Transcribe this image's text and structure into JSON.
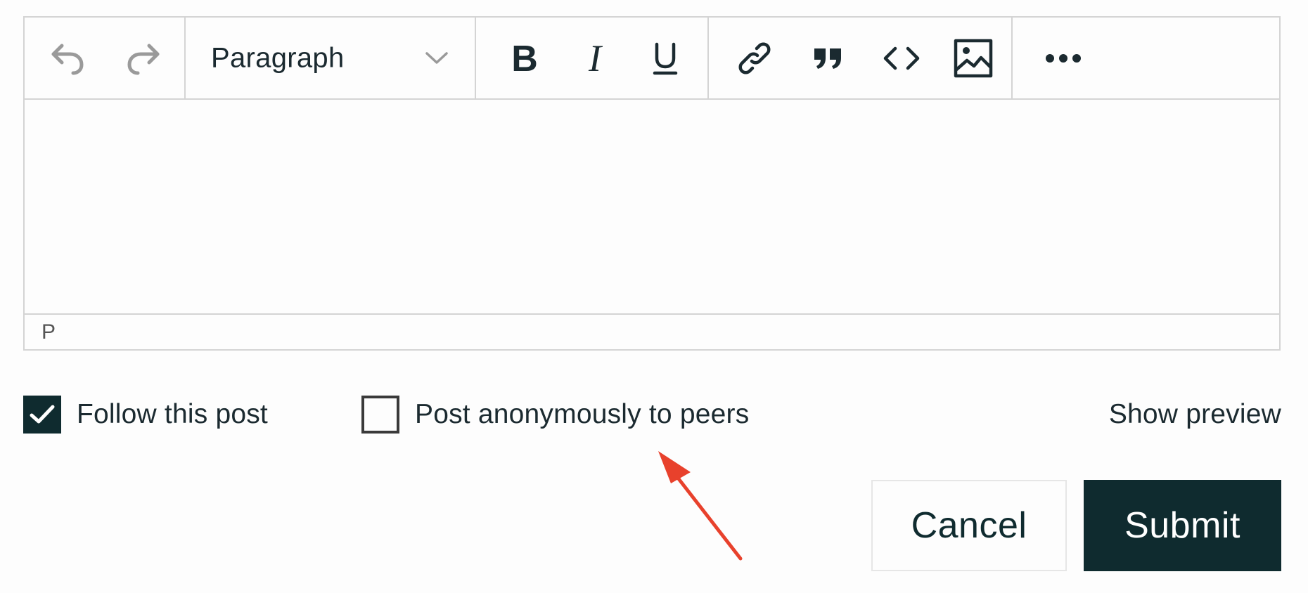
{
  "toolbar": {
    "undo_icon": "undo-icon",
    "redo_icon": "redo-icon",
    "block_format": {
      "selected": "Paragraph",
      "icon": "chevron-down-icon"
    },
    "text_format_icons": [
      "bold-icon",
      "italic-icon",
      "underline-icon"
    ],
    "insert_icons": [
      "link-icon",
      "blockquote-icon",
      "code-icon",
      "image-icon"
    ],
    "more_icon": "more-horizontal-icon"
  },
  "editor": {
    "content": "",
    "status_path": "P"
  },
  "options": {
    "follow_post": {
      "label": "Follow this post",
      "checked": true
    },
    "post_anonymously": {
      "label": "Post anonymously to peers",
      "checked": false
    },
    "show_preview_label": "Show preview"
  },
  "actions": {
    "cancel_label": "Cancel",
    "submit_label": "Submit"
  },
  "colors": {
    "primary_dark": "#0f2b2f",
    "border": "#d4d4d4",
    "annotation_arrow": "#e8412c",
    "icon_muted": "#9a9a9a"
  }
}
